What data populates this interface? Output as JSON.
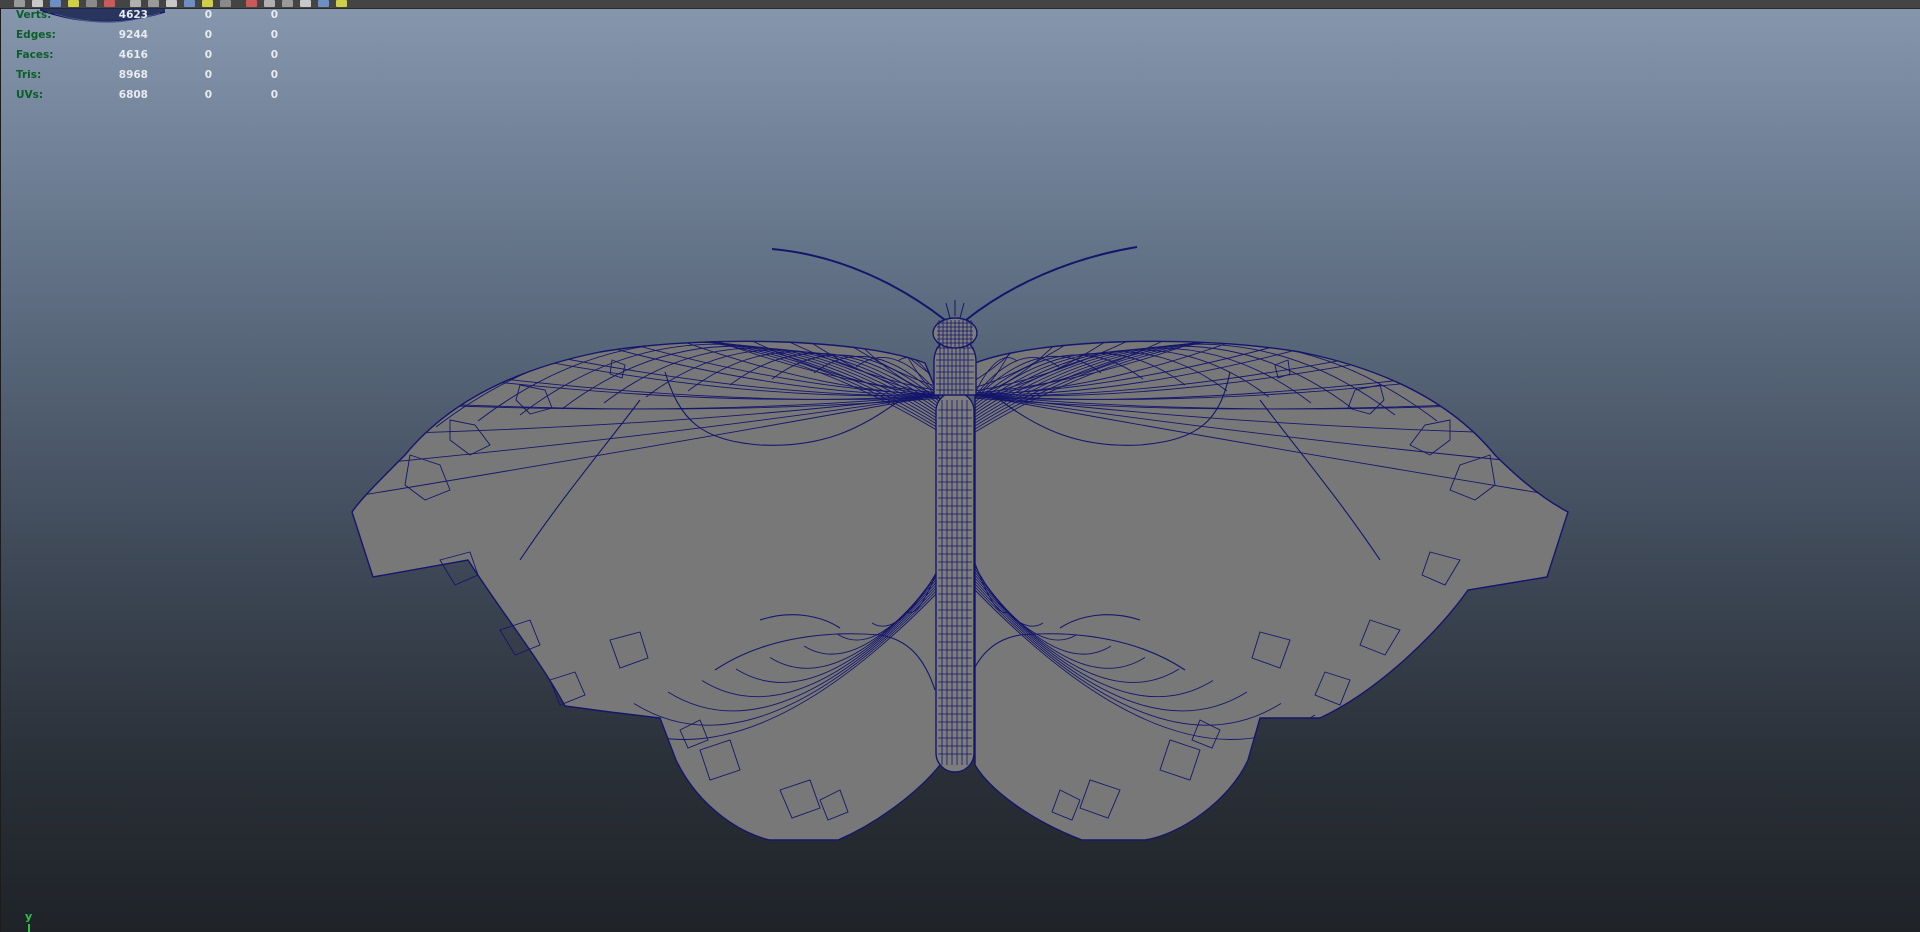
{
  "hud": {
    "rows": [
      {
        "label": "Verts:",
        "values": [
          "4623",
          "0",
          "0"
        ]
      },
      {
        "label": "Edges:",
        "values": [
          "9244",
          "0",
          "0"
        ]
      },
      {
        "label": "Faces:",
        "values": [
          "4616",
          "0",
          "0"
        ]
      },
      {
        "label": "Tris:",
        "values": [
          "8968",
          "0",
          "0"
        ]
      },
      {
        "label": "UVs:",
        "values": [
          "6808",
          "0",
          "0"
        ]
      }
    ]
  },
  "axis_indicator": {
    "label": "y"
  },
  "viewport": {
    "object": "butterfly-mesh",
    "display_mode": "wireframe-on-shaded",
    "wire_color": "#14166b",
    "shade_color": "#787878"
  },
  "colors": {
    "hud_label": "#0a5e29",
    "hud_value": "#e8ecf0",
    "axis_y": "#29c24a"
  },
  "toolbar_icons": [
    "select-icon",
    "lasso-icon",
    "paint-icon",
    "move-icon",
    "rotate-icon",
    "scale-icon",
    "snap-icon",
    "render-icon",
    "camera-icon",
    "wireframe-icon",
    "smooth-shade-icon",
    "texture-icon",
    "light-icon",
    "shadow-icon",
    "isolate-icon",
    "xray-icon",
    "grid-icon",
    "hud-icon"
  ]
}
